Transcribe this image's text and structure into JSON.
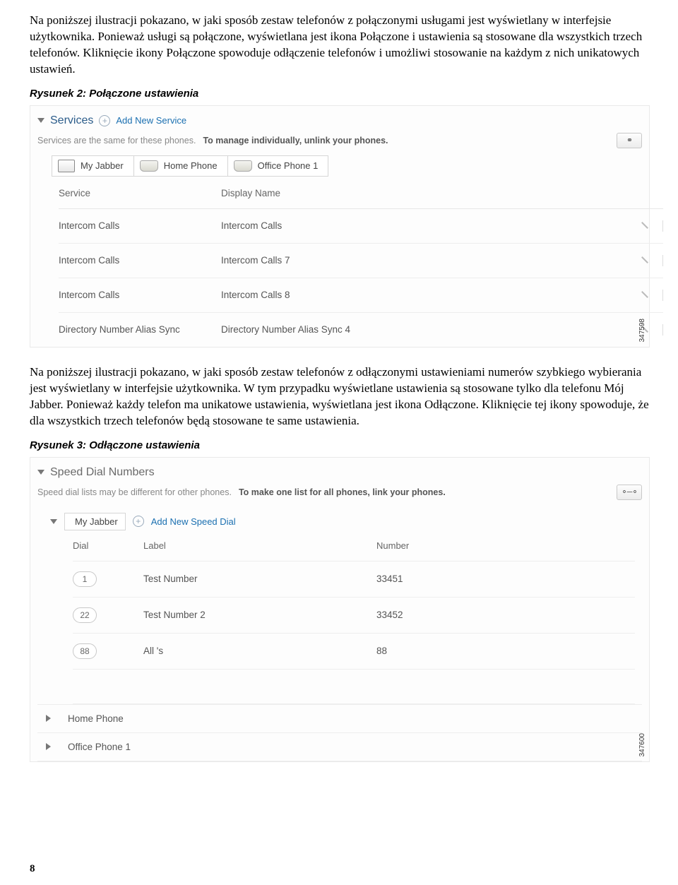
{
  "paragraphs": {
    "p1": "Na poniższej ilustracji pokazano, w jaki sposób zestaw telefonów z połączonymi usługami jest wyświetlany w interfejsie użytkownika. Ponieważ usługi są połączone, wyświetlana jest ikona Połączone i ustawienia są stosowane dla wszystkich trzech telefonów. Kliknięcie ikony Połączone spowoduje odłączenie telefonów i umożliwi stosowanie na każdym z nich unikatowych ustawień.",
    "fig2": "Rysunek 2: Połączone ustawienia",
    "p2": "Na poniższej ilustracji pokazano, w jaki sposób zestaw telefonów z odłączonymi ustawieniami numerów szybkiego wybierania jest wyświetlany w interfejsie użytkownika. W tym przypadku wyświetlane ustawienia są stosowane tylko dla telefonu Mój Jabber. Ponieważ każdy telefon ma unikatowe ustawienia, wyświetlana jest ikona Odłączone. Kliknięcie tej ikony spowoduje, że dla wszystkich trzech telefonów będą stosowane te same ustawienia.",
    "fig3": "Rysunek 3: Odłączone ustawienia"
  },
  "panel1": {
    "title": "Services",
    "addLink": "Add New Service",
    "note_a": "Services are the same for these phones.",
    "note_b": "To manage individually, unlink your phones.",
    "tabs": [
      "My Jabber",
      "Home Phone",
      "Office Phone 1"
    ],
    "headers": {
      "service": "Service",
      "display": "Display Name"
    },
    "rows": [
      {
        "service": "Intercom Calls",
        "display": "Intercom Calls"
      },
      {
        "service": "Intercom Calls",
        "display": "Intercom Calls 7"
      },
      {
        "service": "Intercom Calls",
        "display": "Intercom Calls 8"
      },
      {
        "service": "Directory Number Alias Sync",
        "display": "Directory Number Alias Sync 4"
      }
    ],
    "sideno": "347598"
  },
  "panel2": {
    "title": "Speed Dial Numbers",
    "note_a": "Speed dial lists may be different for other phones.",
    "note_b": "To make one list for all phones, link your phones.",
    "jabber": "My Jabber",
    "addLink": "Add New Speed Dial",
    "headers": {
      "dial": "Dial",
      "label": "Label",
      "number": "Number"
    },
    "rows": [
      {
        "dial": "1",
        "label": "Test Number",
        "number": "33451"
      },
      {
        "dial": "22",
        "label": "Test Number 2",
        "number": "33452"
      },
      {
        "dial": "88",
        "label": "All 's",
        "number": "88"
      }
    ],
    "devices": [
      "Home Phone",
      "Office Phone 1"
    ],
    "sideno": "347600"
  },
  "pageNumber": "8"
}
